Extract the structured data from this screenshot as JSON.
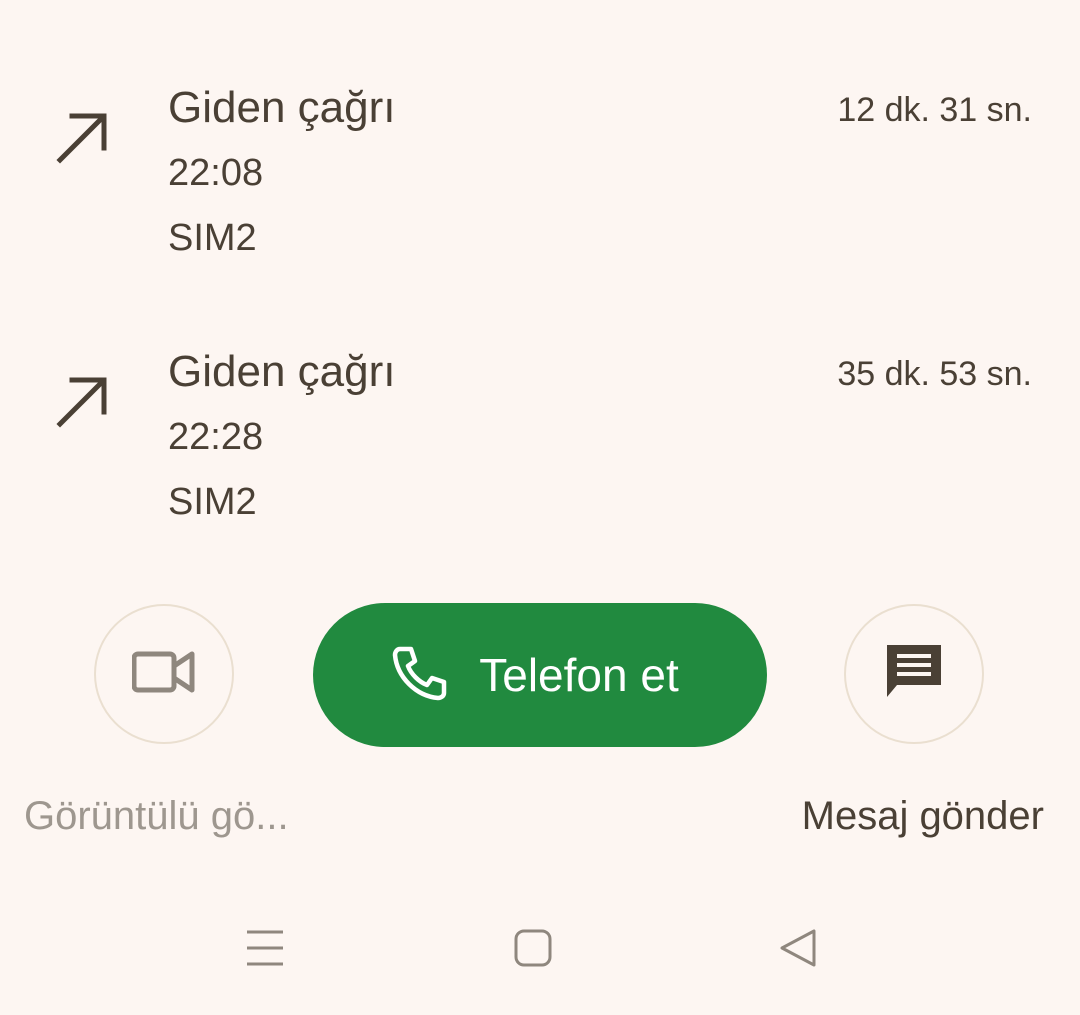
{
  "calls": [
    {
      "type": "Giden çağrı",
      "time": "22:08",
      "sim": "SIM2",
      "duration": "12 dk. 31 sn.",
      "icon": "outgoing-arrow-icon"
    },
    {
      "type": "Giden çağrı",
      "time": "22:28",
      "sim": "SIM2",
      "duration": "35 dk. 53 sn.",
      "icon": "outgoing-arrow-icon"
    }
  ],
  "actions": {
    "video": {
      "label": "Görüntülü gö...",
      "icon": "video-camera-icon"
    },
    "call": {
      "label": "Telefon et",
      "icon": "phone-icon"
    },
    "message": {
      "label": "Mesaj gönder",
      "icon": "message-icon"
    }
  },
  "nav": {
    "menu_icon": "recent-apps-icon",
    "home_icon": "home-icon",
    "back_icon": "back-icon"
  },
  "colors": {
    "background": "#fdf6f2",
    "text": "#4a4035",
    "muted_text": "#9e978f",
    "call_button": "#218a3f",
    "circle_border": "#eadfd0"
  }
}
